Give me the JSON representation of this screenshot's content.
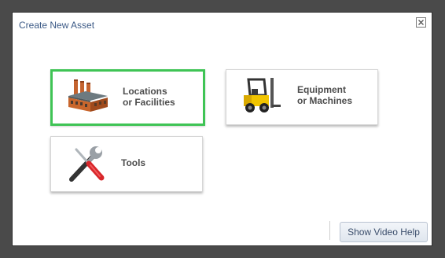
{
  "dialog": {
    "title": "Create New Asset",
    "close_icon": "close-icon"
  },
  "options": [
    {
      "line1": "Locations",
      "line2": "or Facilities",
      "icon": "factory-icon",
      "selected": true,
      "selected_color": "#3fc455"
    },
    {
      "line1": "Equipment",
      "line2": "or Machines",
      "icon": "forklift-icon",
      "selected": false
    },
    {
      "line1": "Tools",
      "icon": "tools-icon",
      "selected": false
    }
  ],
  "footer": {
    "help_label": "Show Video Help"
  }
}
